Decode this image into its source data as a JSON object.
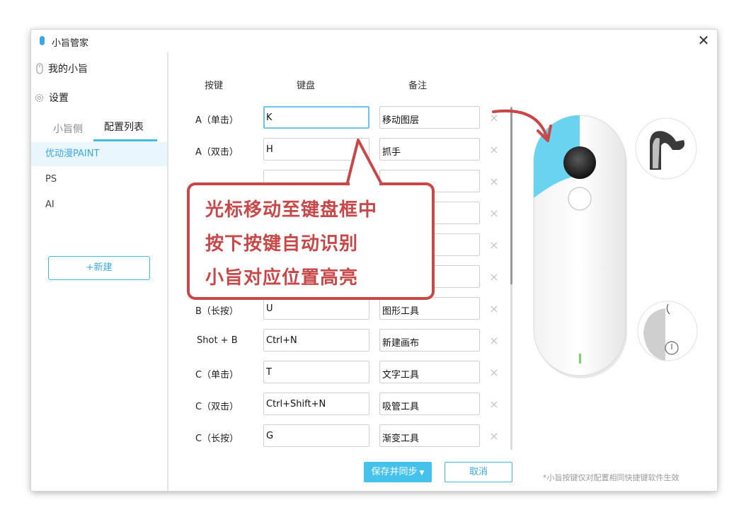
{
  "window": {
    "title": "小旨管家"
  },
  "sidebar": {
    "nav": [
      {
        "label": "我的小旨",
        "icon": "device-icon"
      },
      {
        "label": "设置",
        "icon": "gear-icon"
      }
    ],
    "tabs": [
      {
        "label": "小旨侧",
        "active": false
      },
      {
        "label": "配置列表",
        "active": true
      }
    ],
    "configs": [
      {
        "label": "优动漫PAINT",
        "active": true
      },
      {
        "label": "PS",
        "active": false
      },
      {
        "label": "AI",
        "active": false
      }
    ],
    "new_button": "+新建"
  },
  "table": {
    "headers": {
      "key": "按键",
      "keyboard": "键盘",
      "note": "备注"
    },
    "rows": [
      {
        "key": "A（单击）",
        "keyboard": "K",
        "note": "移动图层"
      },
      {
        "key": "A（双击）",
        "keyboard": "H",
        "note": "抓手"
      },
      {
        "key": "",
        "keyboard": "",
        "note": ""
      },
      {
        "key": "",
        "keyboard": "",
        "note": ""
      },
      {
        "key": "",
        "keyboard": "",
        "note": ""
      },
      {
        "key": "",
        "keyboard": "",
        "note": ""
      },
      {
        "key": "B（长按）",
        "keyboard": "U",
        "note": "图形工具"
      },
      {
        "key": "Shot + B",
        "keyboard": "Ctrl+N",
        "note": "新建画布"
      },
      {
        "key": "C（单击）",
        "keyboard": "T",
        "note": "文字工具"
      },
      {
        "key": "C（双击）",
        "keyboard": "Ctrl+Shift+N",
        "note": "吸管工具"
      },
      {
        "key": "C（长按）",
        "keyboard": "G",
        "note": "渐变工具"
      }
    ],
    "delete_glyph": "×"
  },
  "actions": {
    "save": "保存并同步",
    "save_dropdown_icon": "caret-down-icon",
    "cancel": "取消"
  },
  "footnote": "*小旨按键仅对配置相同快捷键软件生效",
  "callout": {
    "lines": [
      "光标移动至键盘框中",
      "按下按键自动识别",
      "小旨对应位置高亮"
    ]
  },
  "colors": {
    "accent": "#3cbde8",
    "highlight": "#6ad3f0",
    "callout": "#c84849"
  }
}
